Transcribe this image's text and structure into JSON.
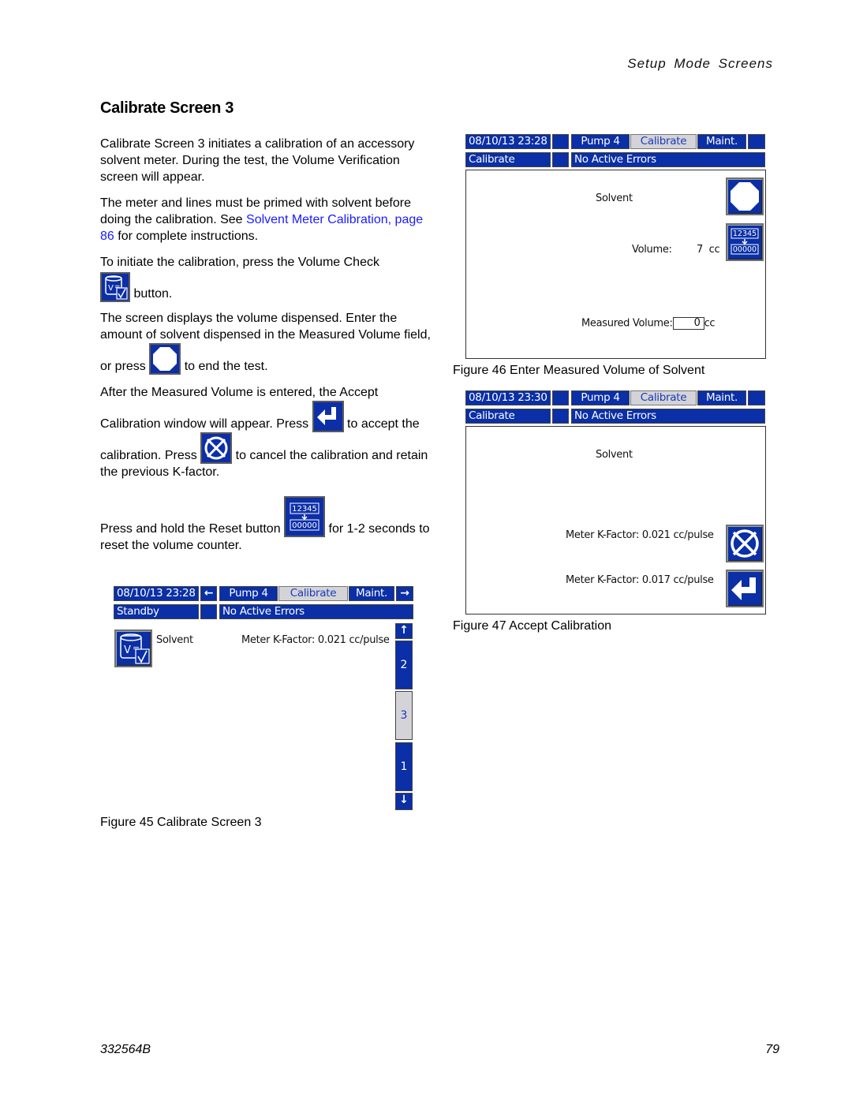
{
  "header": {
    "section": "Setup Mode Screens"
  },
  "title": "Calibrate Screen 3",
  "paragraphs": {
    "p1": "Calibrate Screen 3 initiates a calibration of an accessory solvent meter. During the test, the Volume Verification screen will appear.",
    "p2_a": "The meter and lines must be primed with solvent before doing the calibration.  See ",
    "p2_link": "Solvent Meter Calibration, page 86",
    "p2_b": " for complete instructions.",
    "p3_a": "To initiate the calibration, press the Volume Check",
    "p3_b": " button.",
    "p4_a": "The screen displays the volume dispensed.  Enter the amount of solvent dispensed in the Measured Volume field, or press ",
    "p4_b": " to end the test.",
    "p5_a": "After the Measured Volume is entered, the Accept Calibration window will appear. Press ",
    "p5_b": " to accept the calibration.  Press ",
    "p5_c": " to cancel the calibration and retain the previous K-factor.",
    "p6_a": "Press and hold the Reset button ",
    "p6_b": " for 1-2 seconds to reset the volume counter."
  },
  "icons": {
    "volume_check": "volume-check-icon",
    "stop": "stop-octagon-icon",
    "accept": "enter-arrow-icon",
    "cancel": "cancel-x-icon",
    "reset": "reset-counter-icon"
  },
  "reset_icon": {
    "top": "12345",
    "bottom": "00000"
  },
  "figure45": {
    "caption": "Figure 45  Calibrate Screen 3",
    "datetime": "08/10/13 23:28",
    "tabs": [
      "Pump 4",
      "Calibrate",
      "Maint."
    ],
    "active_tab": "Calibrate",
    "status": "Standby",
    "errors": "No Active Errors",
    "label": "Solvent",
    "kfactor": "Meter K-Factor: 0.021 cc/pulse",
    "scroll_pages": [
      "2",
      "3",
      "1"
    ],
    "active_page": "3"
  },
  "figure46": {
    "caption": "Figure 46  Enter Measured Volume of Solvent",
    "datetime": "08/10/13 23:28",
    "tabs": [
      "Pump 4",
      "Calibrate",
      "Maint."
    ],
    "status": "Calibrate",
    "errors": "No Active Errors",
    "label": "Solvent",
    "volume_label": "Volume:",
    "volume_value": "7",
    "volume_unit": "cc",
    "measured_label": "Measured Volume:",
    "measured_value": "0",
    "measured_unit": "cc"
  },
  "figure47": {
    "caption": "Figure 47  Accept Calibration",
    "datetime": "08/10/13 23:30",
    "tabs": [
      "Pump 4",
      "Calibrate",
      "Maint."
    ],
    "status": "Calibrate",
    "errors": "No Active Errors",
    "label": "Solvent",
    "kfactor_old": "Meter K-Factor: 0.021 cc/pulse",
    "kfactor_new": "Meter K-Factor: 0.017 cc/pulse"
  },
  "footer": {
    "doc_number": "332564B",
    "page": "79"
  },
  "colors": {
    "hmi_blue": "#0a2fa6",
    "hmi_active": "#d4d4d8",
    "link": "#1a1aff"
  }
}
